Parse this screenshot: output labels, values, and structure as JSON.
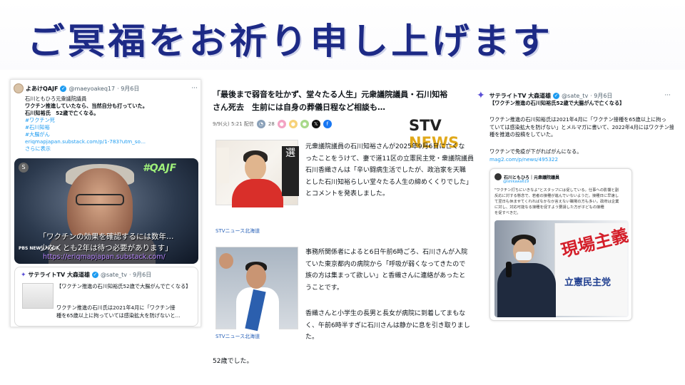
{
  "headline": "ご冥福をお祈り申し上げます",
  "left_tweet": {
    "name": "よあけQAJF",
    "handle": "@maeyoakeq17",
    "date": "· 9月6日",
    "lines": [
      "石川ともひろ元衆議院議員",
      "ワクチン推進していたなら、当然自分も打っていた。",
      "石川知裕氏　52歳で亡くなる。"
    ],
    "tags": [
      "#ワクチン死",
      "#石川知裕",
      "#大腸がん"
    ],
    "link": "eriqmapjapan.substack.com/p/1-783?utm_so…",
    "more": "さらに表示",
    "media": {
      "overlay_tag": "#QAJF",
      "caption1": "「ワクチンの効果を確認するには数年…",
      "caption2": "少なくとも2年は待つ必要があります」",
      "url": "https://eriqmapjapan.substack.com/",
      "network": "PBS NEWS HOUR"
    },
    "quote": {
      "name": "サテライトTV 大森道雄",
      "handle": "@sate_tv",
      "date": "· 9月6日",
      "title": "【ワクチン推進の石川知裕氏52歳で大腸がんで亡くなる】",
      "body1": "ワクチン推進の石川氏は2021年4月に「ワクチン接",
      "body2": "種を65歳以上に拘っていては感染拡大を防げないと…"
    }
  },
  "article": {
    "title1": "「最後まで弱音を吐かず、堂々たる人生」元衆議院議員・石川知裕",
    "title2": "さん死去　生前には自身の葬儀日程など相談も…",
    "date": "9/9(火) 5:21 配信",
    "comments": "28",
    "logo_a": "STV",
    "logo_b": "NEWS",
    "photo1_sign": "選",
    "credit1": "STVニュース北海道",
    "credit2": "STVニュース北海道",
    "para1": [
      "元衆議院議員の石川知裕さんが2025年9月6日に亡くな",
      "ったことをうけて、妻で道11区の立憲民主党・衆議院議員",
      "石川香織さんは「辛い闘病生活でしたが、政治家を天職",
      "とした石川知裕らしい堂々たる人生の締めくくりでした」",
      "とコメントを発表しました。"
    ],
    "para2": [
      "事務所関係者によると6日午前6時ごろ、石川さんが入院",
      "ていた東京都内の病院から「呼吸が弱くなってきたので",
      "族の方は集まって欲しい」と香織さんに連絡があったと",
      "うことです。"
    ],
    "para3": [
      "香織さんと小学生の長男と長女が病院に到着してまもな",
      "く、午前6時半すぎに石川さんは静かに息を引き取りまし",
      "た。"
    ],
    "closing": "52歳でした。"
  },
  "right_tweet": {
    "name": "サテライトTV 大森道雄",
    "handle": "@sate_tv",
    "date": "· 9月6日",
    "title": "【ワクチン推進の石川知裕氏52歳で大腸がんで亡くなる】",
    "p1": [
      "ワクチン推進の石川知裕氏は2021年4月に「ワクチン接種を65歳以上に拘っ",
      "ていては感染拡大を防げない」とメルマガに書いて、2022年4月にはワクチン接",
      "種を推進の投稿をしていた。"
    ],
    "p2": "ワクチンで免疫が下がればがんになる。",
    "link": "mag2.com/p/news/495322",
    "inner": {
      "name": "石川ともひろ｜元衆議院議員",
      "handle": "@ishikawa619",
      "text": [
        "\"ワクチン打ちにいきなよ\"とスタッフには促している。仕事への影響と副",
        "反応に対する懸念で、若者の接種が進んでいないようだ。接種日に早速し",
        "て翌日も休ませてくれればなかなか言えない職場の方も多い。政府は企業",
        "に対し、対応可能なる接種を促すよう要請した方が子どもの接種",
        "を促すべきだ。"
      ],
      "banner_red": "現場主義",
      "banner_blue": "立憲民主党"
    }
  },
  "colors": {
    "headline": "#1d2a86",
    "link": "#1d9bf0",
    "stv_accent": "#e0a81a"
  }
}
